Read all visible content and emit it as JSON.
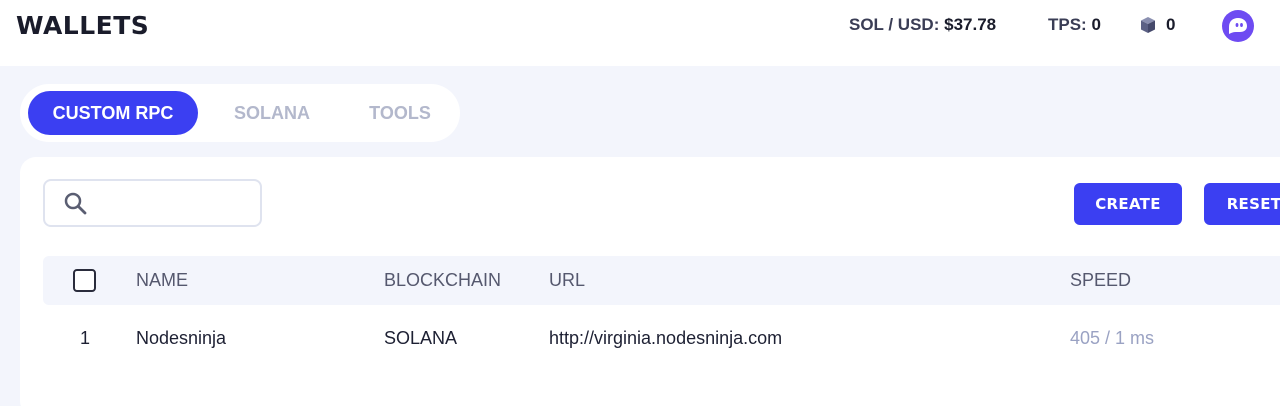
{
  "header": {
    "title": "WALLETS",
    "price_label": "SOL / USD:",
    "price_value": "$37.78",
    "tps_label": "TPS:",
    "tps_value": "0",
    "blocks_value": "0"
  },
  "tabs": [
    {
      "label": "CUSTOM RPC",
      "active": true
    },
    {
      "label": "SOLANA",
      "active": false
    },
    {
      "label": "TOOLS",
      "active": false
    }
  ],
  "search": {
    "value": "",
    "placeholder": ""
  },
  "actions": {
    "create_label": "CREATE",
    "reset_label": "RESET"
  },
  "table": {
    "columns": [
      "NAME",
      "BLOCKCHAIN",
      "URL",
      "SPEED"
    ],
    "rows": [
      {
        "index": "1",
        "name": "Nodesninja",
        "blockchain": "SOLANA",
        "url": "http://virginia.nodesninja.com",
        "speed": "405 / 1 ms"
      }
    ]
  },
  "colors": {
    "accent": "#3b3ff2",
    "background": "#f3f5fc",
    "avatar": "#6e4bf2",
    "muted": "#b3b8cc"
  },
  "icons": [
    "search-icon",
    "cube-icon",
    "ghost-avatar-icon"
  ]
}
